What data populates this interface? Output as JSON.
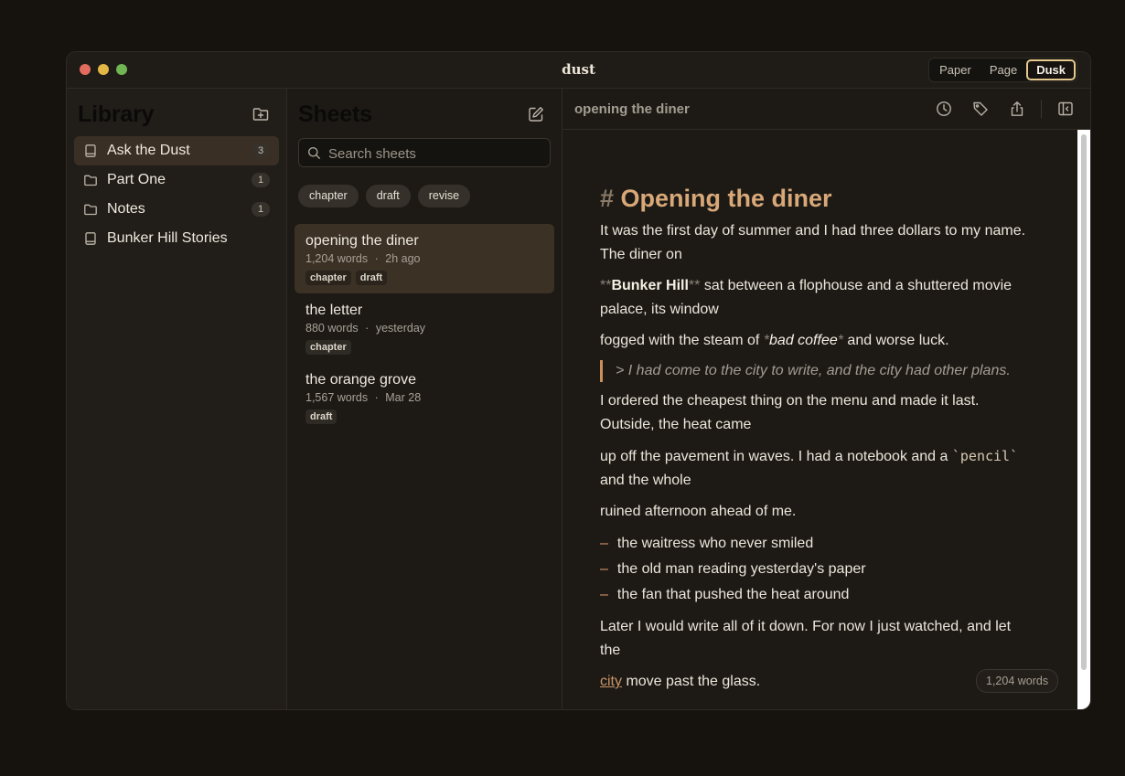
{
  "app": {
    "title": "dust"
  },
  "theme_switch": {
    "options": [
      "Paper",
      "Page",
      "Dusk"
    ],
    "selected": "Dusk"
  },
  "library": {
    "title": "Library",
    "items": [
      {
        "label": "Ask the Dust",
        "icon": "book-icon",
        "count": "3",
        "selected": true
      },
      {
        "label": "Part One",
        "icon": "folder-icon",
        "count": "1"
      },
      {
        "label": "Notes",
        "icon": "folder-icon",
        "count": "1"
      },
      {
        "label": "Bunker Hill Stories",
        "icon": "book-icon",
        "count": ""
      }
    ]
  },
  "sheets": {
    "title": "Sheets",
    "search_placeholder": "Search sheets",
    "filters": [
      "chapter",
      "draft",
      "revise"
    ],
    "items": [
      {
        "title": "opening the diner",
        "words": "1,204 words",
        "sep": "·",
        "time": "2h ago",
        "tags": [
          "chapter",
          "draft"
        ],
        "selected": true
      },
      {
        "title": "the letter",
        "words": "880 words",
        "sep": "·",
        "time": "yesterday",
        "tags": [
          "chapter"
        ]
      },
      {
        "title": "the orange grove",
        "words": "1,567 words",
        "sep": "·",
        "time": "Mar 28",
        "tags": [
          "draft"
        ]
      }
    ]
  },
  "editor": {
    "title": "opening the diner",
    "heading_marker": "#",
    "heading": "Opening the diner",
    "p1": "It was the first day of summer and I had three dollars to my name. The diner on",
    "p2_bold_marker": "**",
    "p2_bold": "Bunker Hill",
    "p2_rest": " sat between a flophouse and a shuttered movie palace, its window",
    "p3_start": "fogged with the steam of ",
    "p3_italic_marker": "*",
    "p3_italic": "bad coffee",
    "p3_end": " and worse luck.",
    "quote": "> I had come to the city to write, and the city had other plans.",
    "p4": "I ordered the cheapest thing on the menu and made it last. Outside, the heat came",
    "p5_start": "up off the pavement in waves. I had a notebook and a ",
    "p5_code": "`pencil`",
    "p5_end": " and the whole",
    "p6": "ruined afternoon ahead of me.",
    "list_marker": "–",
    "list": [
      "the waitress who never smiled",
      "the old man reading yesterday's paper",
      "the fan that pushed the heat around"
    ],
    "p7": "Later I would write all of it down. For now I just watched, and let the",
    "p8_link": "city",
    "p8_rest": " move past the glass.",
    "word_count": "1,204 words"
  },
  "colors": {
    "accent": "#d8a878",
    "selected_bg": "#3b3124",
    "window_bg": "#1f1c17"
  }
}
